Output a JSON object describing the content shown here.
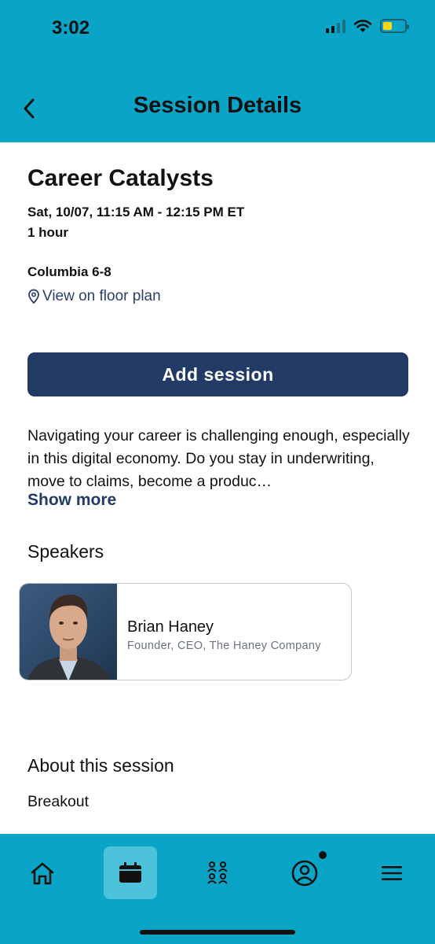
{
  "status_bar": {
    "time": "3:02"
  },
  "header": {
    "title": "Session Details"
  },
  "session": {
    "title": "Career Catalysts",
    "datetime": "Sat, 10/07, 11:15 AM - 12:15 PM ET",
    "duration": "1 hour",
    "room": "Columbia 6-8",
    "floor_plan_link": "View on floor plan",
    "add_button": "Add session",
    "description": "Navigating your career is challenging enough, especially in this digital economy. Do you stay in underwriting, move to claims, become a produc…",
    "show_more": "Show more"
  },
  "speakers": {
    "heading": "Speakers",
    "items": [
      {
        "name": "Brian Haney",
        "role": "Founder, CEO, The Haney Company"
      }
    ]
  },
  "about": {
    "heading": "About this session",
    "type": "Breakout"
  },
  "tabbar": {
    "items": [
      {
        "icon": "home-icon",
        "active": false
      },
      {
        "icon": "calendar-icon",
        "active": true
      },
      {
        "icon": "people-icon",
        "active": false
      },
      {
        "icon": "profile-icon",
        "active": false,
        "badge": true
      },
      {
        "icon": "menu-icon",
        "active": false
      }
    ]
  },
  "colors": {
    "header": "#0aa5c6",
    "primary": "#223a66",
    "tab_active": "#4cc3da",
    "battery": "#ffd60a"
  }
}
